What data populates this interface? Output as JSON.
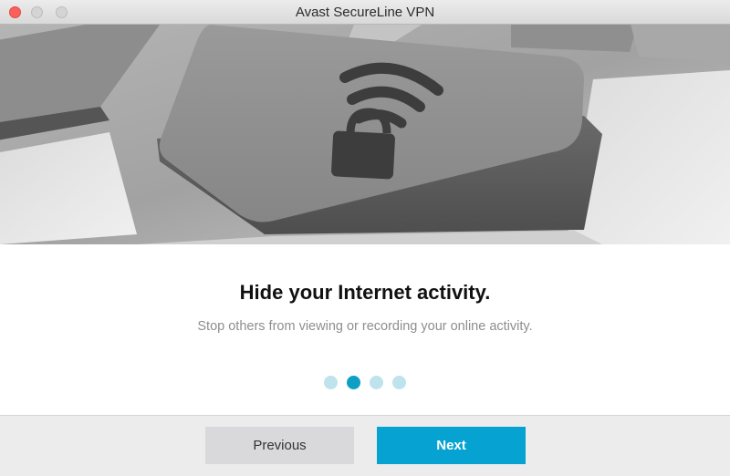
{
  "window": {
    "title": "Avast SecureLine VPN"
  },
  "hero": {
    "icon": "wifi-lock-icon"
  },
  "slide": {
    "headline": "Hide your Internet activity.",
    "subtext": "Stop others from viewing or recording your online activity.",
    "current_step": 2,
    "total_steps": 4
  },
  "footer": {
    "previous_label": "Previous",
    "next_label": "Next"
  },
  "colors": {
    "accent": "#06a3d2",
    "dot_active": "#0d9fc4",
    "dot_inactive": "#bfe3ec"
  }
}
